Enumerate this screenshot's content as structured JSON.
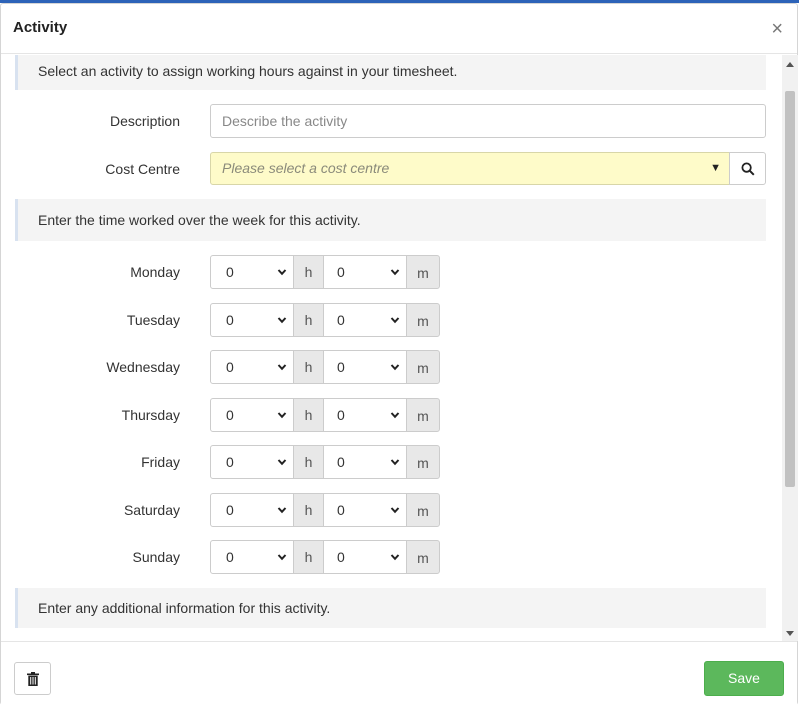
{
  "dialog": {
    "title": "Activity",
    "close_symbol": "×"
  },
  "intro": {
    "text": "Select an activity to assign working hours against in your timesheet."
  },
  "description": {
    "label": "Description",
    "placeholder": "Describe the activity",
    "value": ""
  },
  "cost_centre": {
    "label": "Cost Centre",
    "placeholder": "Please select a cost centre",
    "search_icon": "search-icon"
  },
  "time_section": {
    "text": "Enter the time worked over the week for this activity.",
    "hours_unit": "h",
    "minutes_unit": "m",
    "days": [
      {
        "label": "Monday",
        "hours": "0",
        "minutes": "0"
      },
      {
        "label": "Tuesday",
        "hours": "0",
        "minutes": "0"
      },
      {
        "label": "Wednesday",
        "hours": "0",
        "minutes": "0"
      },
      {
        "label": "Thursday",
        "hours": "0",
        "minutes": "0"
      },
      {
        "label": "Friday",
        "hours": "0",
        "minutes": "0"
      },
      {
        "label": "Saturday",
        "hours": "0",
        "minutes": "0"
      },
      {
        "label": "Sunday",
        "hours": "0",
        "minutes": "0"
      }
    ]
  },
  "additional": {
    "text": "Enter any additional information for this activity."
  },
  "footer": {
    "delete_icon": "trash-icon",
    "save_label": "Save"
  },
  "colors": {
    "accent_bar": "#2d63b8",
    "cost_centre_bg": "#fefbc9",
    "save_button": "#5cb85c"
  }
}
